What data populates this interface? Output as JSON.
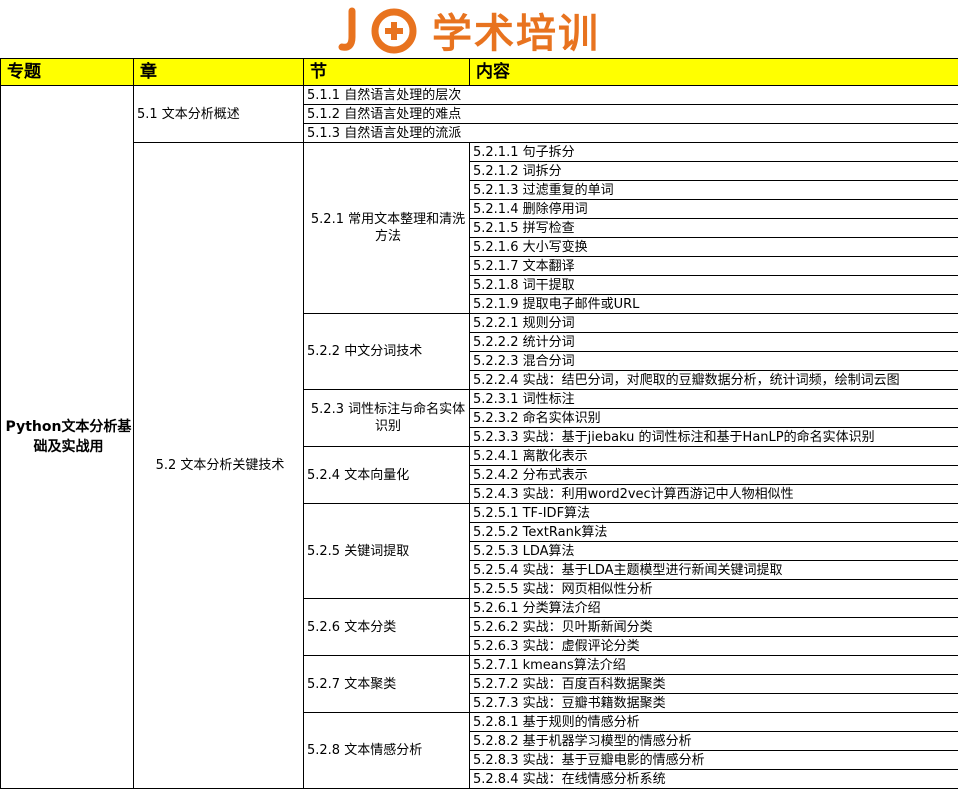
{
  "header": {
    "logo_mark": "JG",
    "logo_text": "学术培训",
    "brand_color": "#e8731f"
  },
  "columns": [
    "专题",
    "章",
    "节",
    "内容"
  ],
  "topic": "Python文本分析基础及实战用",
  "chapter1": {
    "label": "5.1 文本分析概述",
    "sections": [
      "5.1.1 自然语言处理的层次",
      "5.1.2 自然语言处理的难点",
      "5.1.3 自然语言处理的流派"
    ]
  },
  "chapter2": {
    "label": "5.2 文本分析关键技术",
    "sections": [
      {
        "label": "5.2.1 常用文本整理和清洗方法",
        "items": [
          "5.2.1.1 句子拆分",
          "5.2.1.2 词拆分",
          "5.2.1.3 过滤重复的单词",
          "5.2.1.4 删除停用词",
          "5.2.1.5 拼写检查",
          "5.2.1.6 大小写变换",
          "5.2.1.7 文本翻译",
          "5.2.1.8 词干提取",
          "5.2.1.9 提取电子邮件或URL"
        ]
      },
      {
        "label": "5.2.2 中文分词技术",
        "items": [
          "5.2.2.1 规则分词",
          "5.2.2.2 统计分词",
          "5.2.2.3 混合分词",
          "5.2.2.4 实战：结巴分词，对爬取的豆瓣数据分析，统计词频，绘制词云图"
        ]
      },
      {
        "label": "5.2.3 词性标注与命名实体识别",
        "items": [
          "5.2.3.1 词性标注",
          "5.2.3.2 命名实体识别",
          "5.2.3.3 实战：基于jiebaku 的词性标注和基于HanLP的命名实体识别"
        ]
      },
      {
        "label": "5.2.4 文本向量化",
        "items": [
          "5.2.4.1 离散化表示",
          "5.2.4.2 分布式表示",
          "5.2.4.3 实战：利用word2vec计算西游记中人物相似性"
        ]
      },
      {
        "label": "5.2.5 关键词提取",
        "items": [
          "5.2.5.1 TF-IDF算法",
          "5.2.5.2 TextRank算法",
          "5.2.5.3 LDA算法",
          "5.2.5.4 实战：基于LDA主题模型进行新闻关键词提取",
          "5.2.5.5 实战：网页相似性分析"
        ]
      },
      {
        "label": "5.2.6 文本分类",
        "items": [
          "5.2.6.1 分类算法介绍",
          "5.2.6.2 实战：贝叶斯新闻分类",
          "5.2.6.3 实战：虚假评论分类"
        ]
      },
      {
        "label": "5.2.7 文本聚类",
        "items": [
          "5.2.7.1 kmeans算法介绍",
          "5.2.7.2 实战：百度百科数据聚类",
          "5.2.7.3 实战：豆瓣书籍数据聚类"
        ]
      },
      {
        "label": "5.2.8 文本情感分析",
        "items": [
          "5.2.8.1 基于规则的情感分析",
          "5.2.8.2 基于机器学习模型的情感分析",
          "5.2.8.3 实战：基于豆瓣电影的情感分析",
          "5.2.8.4 实战：在线情感分析系统"
        ]
      }
    ]
  }
}
